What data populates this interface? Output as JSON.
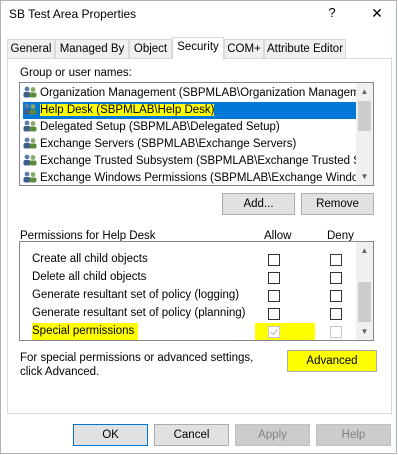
{
  "window": {
    "title": "SB Test Area Properties",
    "help_glyph": "?",
    "close_glyph": "✕"
  },
  "tabs": [
    {
      "label": "General"
    },
    {
      "label": "Managed By"
    },
    {
      "label": "Object"
    },
    {
      "label": "Security",
      "active": true
    },
    {
      "label": "COM+"
    },
    {
      "label": "Attribute Editor"
    }
  ],
  "security": {
    "group_label": "Group or user names:",
    "users": [
      {
        "name": "Organization Management (SBPMLAB\\Organization Manageme..."
      },
      {
        "name": "Help Desk (SBPMLAB\\Help Desk)",
        "selected": true
      },
      {
        "name": "Delegated Setup (SBPMLAB\\Delegated Setup)"
      },
      {
        "name": "Exchange Servers (SBPMLAB\\Exchange Servers)"
      },
      {
        "name": "Exchange Trusted Subsystem (SBPMLAB\\Exchange Trusted S..."
      },
      {
        "name": "Exchange Windows Permissions (SBPMLAB\\Exchange Windo..."
      }
    ],
    "add_label": "Add...",
    "remove_label": "Remove",
    "permissions_for": "Permissions for Help Desk",
    "allow_header": "Allow",
    "deny_header": "Deny",
    "permissions": [
      {
        "name": "Create all child objects",
        "allow": false,
        "deny": false
      },
      {
        "name": "Delete all child objects",
        "allow": false,
        "deny": false
      },
      {
        "name": "Generate resultant set of policy (logging)",
        "allow": false,
        "deny": false
      },
      {
        "name": "Generate resultant set of policy (planning)",
        "allow": false,
        "deny": false
      },
      {
        "name": "Special permissions",
        "allow": true,
        "deny": false,
        "disabled": true,
        "highlighted": true
      }
    ],
    "advanced_note": "For special permissions or advanced settings, click Advanced.",
    "advanced_label": "Advanced"
  },
  "footer": {
    "ok": "OK",
    "cancel": "Cancel",
    "apply": "Apply",
    "help": "Help"
  },
  "colors": {
    "highlight": "#ffff00",
    "selection": "#0078d7"
  }
}
